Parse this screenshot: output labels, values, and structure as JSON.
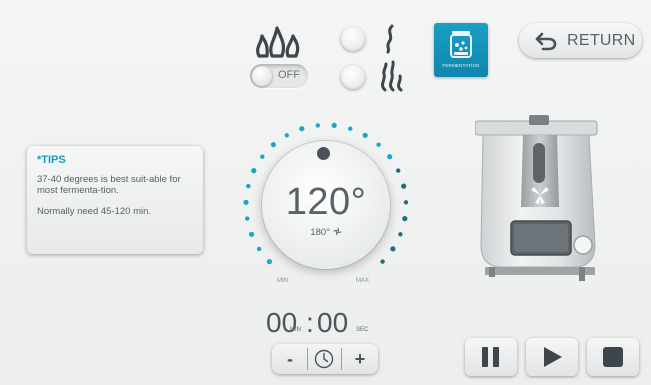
{
  "header": {
    "heat_toggle": {
      "state_label": "OFF",
      "icon": "flame-icon"
    },
    "steam_options": [
      {
        "icon": "steam-light-icon"
      },
      {
        "icon": "steam-heavy-icon"
      }
    ],
    "mode_button": {
      "label": "FERMENTATION",
      "icon": "fermentation-jar-icon",
      "color": "#1798c0"
    },
    "return_button": {
      "label": "RETURN",
      "icon": "return-arrow-icon"
    }
  },
  "tips": {
    "title": "*TIPS",
    "line1": "37-40 degrees is best suit-able for most fermenta-tion.",
    "line2": "Normally need 45-120 min."
  },
  "dial": {
    "temperature": "120°",
    "secondary": "180°",
    "min_label": "MIN",
    "max_label": "MAX",
    "accent_color": "#1aa6c9"
  },
  "timer": {
    "minutes": "00",
    "colon": ":",
    "seconds": "00",
    "min_unit": "MIN",
    "sec_unit": "SEC",
    "decrement": "-",
    "increment": "+"
  },
  "controls": {
    "pause_icon": "pause-icon",
    "play_icon": "play-icon",
    "stop_icon": "stop-icon"
  }
}
